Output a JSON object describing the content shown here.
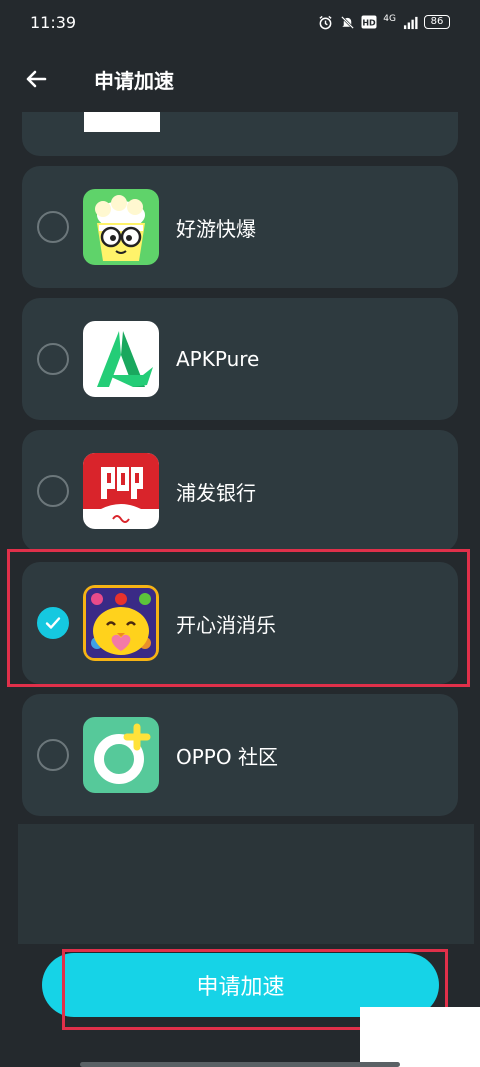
{
  "status_bar": {
    "time": "11:39",
    "icons": [
      "alarm-icon",
      "mute-icon",
      "hd-icon",
      "signal-4g-icon",
      "signal-bars-icon"
    ],
    "network": "4G",
    "battery": "86"
  },
  "header": {
    "title": "申请加速",
    "back_icon": "back-arrow-icon"
  },
  "apps": [
    {
      "name": "好游快爆",
      "selected": false,
      "icon": "haoyou-kuaibao-app-icon"
    },
    {
      "name": "APKPure",
      "selected": false,
      "icon": "apkpure-app-icon"
    },
    {
      "name": "浦发银行",
      "selected": false,
      "icon": "spdb-app-icon"
    },
    {
      "name": "开心消消乐",
      "selected": true,
      "icon": "happy-elimination-app-icon"
    },
    {
      "name": "OPPO 社区",
      "selected": false,
      "icon": "oppo-community-app-icon"
    }
  ],
  "footer": {
    "apply_label": "申请加速"
  },
  "colors": {
    "background": "#24292d",
    "card": "#2e3a3f",
    "accent": "#16d3e7",
    "highlight": "#e0304a"
  }
}
